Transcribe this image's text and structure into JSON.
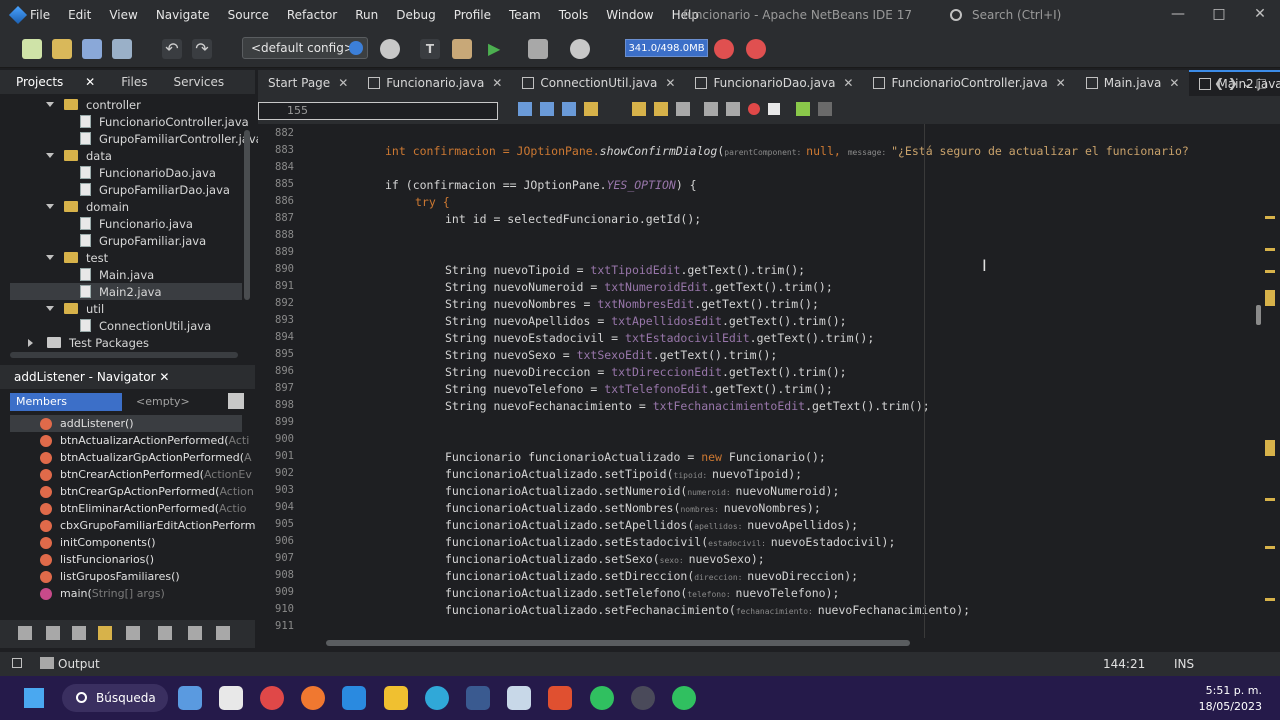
{
  "window": {
    "title": "funcionario - Apache NetBeans IDE 17",
    "menu": [
      "File",
      "Edit",
      "View",
      "Navigate",
      "Source",
      "Refactor",
      "Run",
      "Debug",
      "Profile",
      "Team",
      "Tools",
      "Window",
      "Help"
    ],
    "search_placeholder": "Search (Ctrl+I)"
  },
  "toolbar": {
    "config": "<default config>",
    "memory": "341.0/498.0MB"
  },
  "projects_panel": {
    "tabs": [
      "Projects",
      "Files",
      "Services"
    ],
    "tree": [
      {
        "label": "controller",
        "type": "folder"
      },
      {
        "label": "FuncionarioController.java",
        "type": "file"
      },
      {
        "label": "GrupoFamiliarController.java",
        "type": "file"
      },
      {
        "label": "data",
        "type": "folder"
      },
      {
        "label": "FuncionarioDao.java",
        "type": "file"
      },
      {
        "label": "GrupoFamiliarDao.java",
        "type": "file"
      },
      {
        "label": "domain",
        "type": "folder"
      },
      {
        "label": "Funcionario.java",
        "type": "file"
      },
      {
        "label": "GrupoFamiliar.java",
        "type": "file"
      },
      {
        "label": "test",
        "type": "folder"
      },
      {
        "label": "Main.java",
        "type": "file"
      },
      {
        "label": "Main2.java",
        "type": "file",
        "selected": true
      },
      {
        "label": "util",
        "type": "folder"
      },
      {
        "label": "ConnectionUtil.java",
        "type": "file"
      },
      {
        "label": "Test Packages",
        "type": "root"
      }
    ]
  },
  "navigator": {
    "title": "addListener - Navigator",
    "members_label": "Members",
    "filter_label": "<empty>",
    "items": [
      {
        "label": "addListener()",
        "dim": ""
      },
      {
        "label": "btnActualizarActionPerformed(",
        "dim": "Acti"
      },
      {
        "label": "btnActualizarGpActionPerformed(",
        "dim": "A"
      },
      {
        "label": "btnCrearActionPerformed(",
        "dim": "ActionEv"
      },
      {
        "label": "btnCrearGpActionPerformed(",
        "dim": "Action"
      },
      {
        "label": "btnEliminarActionPerformed(",
        "dim": "Actio"
      },
      {
        "label": "cbxGrupoFamiliarEditActionPerform",
        "dim": ""
      },
      {
        "label": "initComponents()",
        "dim": ""
      },
      {
        "label": "listFuncionarios()",
        "dim": ""
      },
      {
        "label": "listGruposFamiliares()",
        "dim": ""
      },
      {
        "label": "main(",
        "dim": "String[] args)"
      }
    ]
  },
  "editor": {
    "tabs": [
      "Start Page",
      "Funcionario.java",
      "ConnectionUtil.java",
      "FuncionarioDao.java",
      "FuncionarioController.java",
      "Main.java",
      "Main2.java"
    ],
    "active_tab": "Main2.java",
    "goto_line": "155",
    "line_numbers": [
      "882",
      "883",
      "884",
      "885",
      "886",
      "887",
      "888",
      "889",
      "890",
      "891",
      "892",
      "893",
      "894",
      "895",
      "896",
      "897",
      "898",
      "899",
      "900",
      "901",
      "902",
      "903",
      "904",
      "905",
      "906",
      "907",
      "908",
      "909",
      "910",
      "911"
    ],
    "code": {
      "l883_a": "int confirmacion = JOptionPane.",
      "l883_b": "showConfirmDialog",
      "l883_c": "(",
      "l883_hint1": "parentComponent: ",
      "l883_d": "null, ",
      "l883_hint2": "message: ",
      "l883_str": "\"¿Está seguro de actualizar el funcionario?",
      "l885_a": "if (confirmacion == JOptionPane.",
      "l885_b": "YES_OPTION",
      "l885_c": ") {",
      "l886": "try {",
      "l887": "int id = selectedFuncionario.getId();",
      "string_lines": [
        {
          "var": "nuevoTipoid",
          "field": "txtTipoidEdit"
        },
        {
          "var": "nuevoNumeroid",
          "field": "txtNumeroidEdit"
        },
        {
          "var": "nuevoNombres",
          "field": "txtNombresEdit"
        },
        {
          "var": "nuevoApellidos",
          "field": "txtApellidosEdit"
        },
        {
          "var": "nuevoEstadocivil",
          "field": "txtEstadocivilEdit"
        },
        {
          "var": "nuevoSexo",
          "field": "txtSexoEdit"
        },
        {
          "var": "nuevoDireccion",
          "field": "txtDireccionEdit"
        },
        {
          "var": "nuevoTelefono",
          "field": "txtTelefonoEdit"
        },
        {
          "var": "nuevoFechanacimiento",
          "field": "txtFechanacimientoEdit"
        }
      ],
      "l901": "Funcionario funcionarioActualizado = ",
      "l901_new": "new",
      "l901_b": " Funcionario();",
      "setter_lines": [
        {
          "method": "setTipoid",
          "hint": "tipoid: ",
          "arg": "nuevoTipoid"
        },
        {
          "method": "setNumeroid",
          "hint": "numeroid: ",
          "arg": "nuevoNumeroid"
        },
        {
          "method": "setNombres",
          "hint": "nombres: ",
          "arg": "nuevoNombres"
        },
        {
          "method": "setApellidos",
          "hint": "apellidos: ",
          "arg": "nuevoApellidos"
        },
        {
          "method": "setEstadocivil",
          "hint": "estadocivil: ",
          "arg": "nuevoEstadocivil"
        },
        {
          "method": "setSexo",
          "hint": "sexo: ",
          "arg": "nuevoSexo"
        },
        {
          "method": "setDireccion",
          "hint": "direccion: ",
          "arg": "nuevoDireccion"
        },
        {
          "method": "setTelefono",
          "hint": "telefono: ",
          "arg": "nuevoTelefono"
        },
        {
          "method": "setFechanacimiento",
          "hint": "fechanacimiento: ",
          "arg": "nuevoFechanacimiento"
        }
      ]
    }
  },
  "statusbar": {
    "output_label": "Output",
    "position": "144:21",
    "mode": "INS"
  },
  "taskbar": {
    "search_label": "Búsqueda",
    "time": "5:51 p. m.",
    "date": "18/05/2023"
  }
}
